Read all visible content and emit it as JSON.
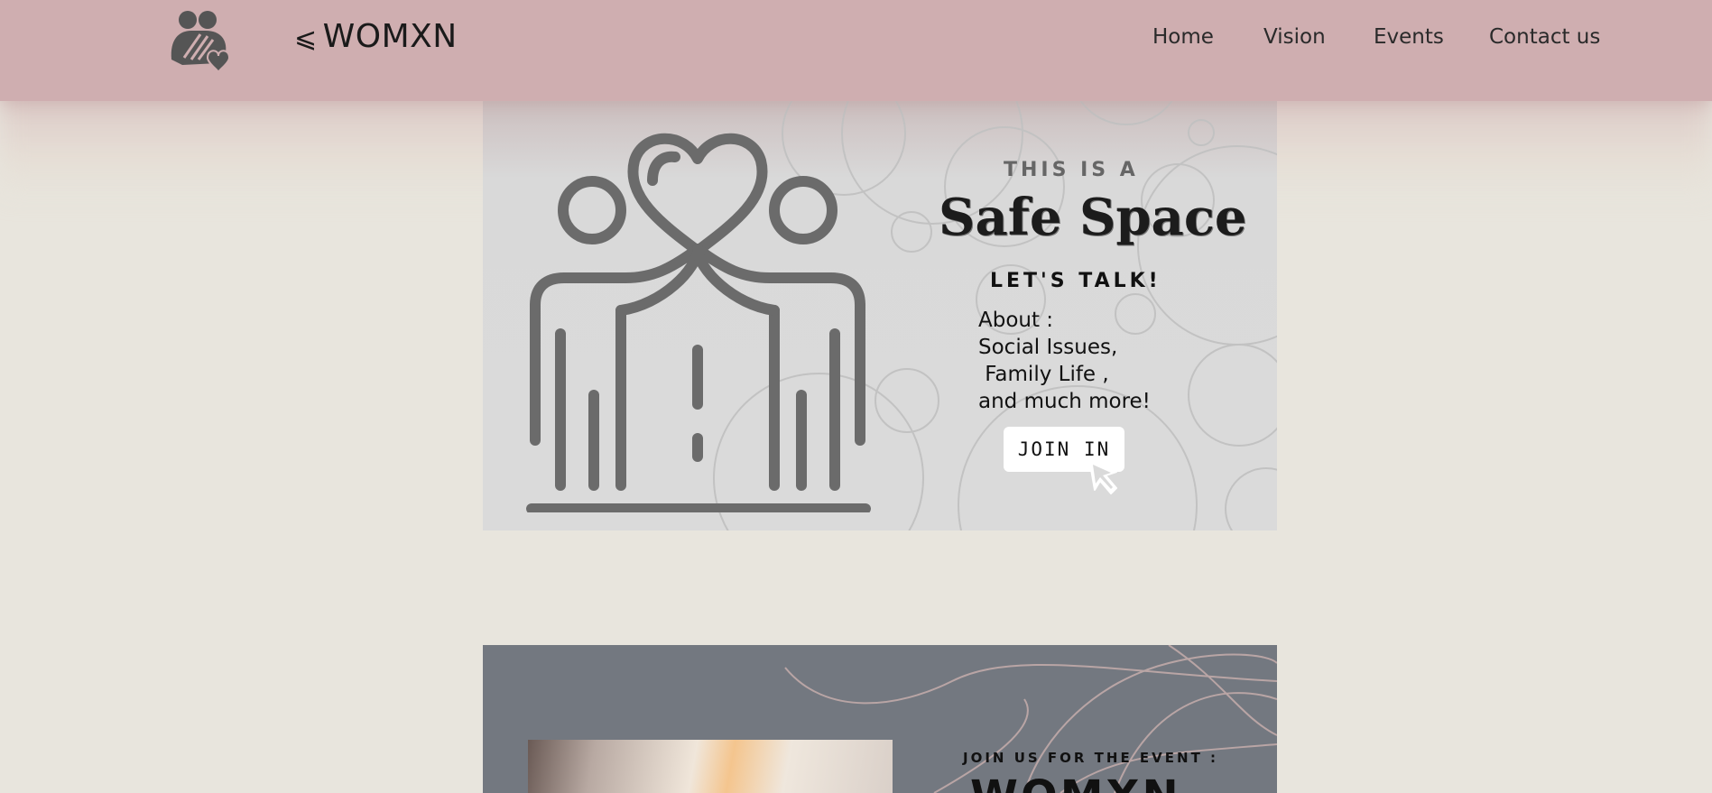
{
  "header": {
    "brand_mark": "⩽",
    "brand": "WOMXN",
    "logo_icon": "women-heart-logo-icon",
    "nav": [
      "Home",
      "Vision",
      "Events",
      "Contact us"
    ]
  },
  "hero": {
    "tag": "THIS IS A",
    "title": "Safe Space",
    "subtitle": "LET'S TALK!",
    "about": "About :\nSocial Issues,\n Family Life ,\nand much more!",
    "button": "JOIN IN",
    "illustration_icon": "two-people-heart-icon",
    "cursor_icon": "pointer-cursor-icon"
  },
  "event": {
    "tag": "JOIN US FOR THE EVENT :",
    "title": "WOMXN"
  },
  "colors": {
    "navbar": "#cfaeb0",
    "page_bg": "#e8e5dd",
    "hero_bg": "#dadada",
    "event_bg": "#737880",
    "icon_gray": "#6b6b6b"
  }
}
